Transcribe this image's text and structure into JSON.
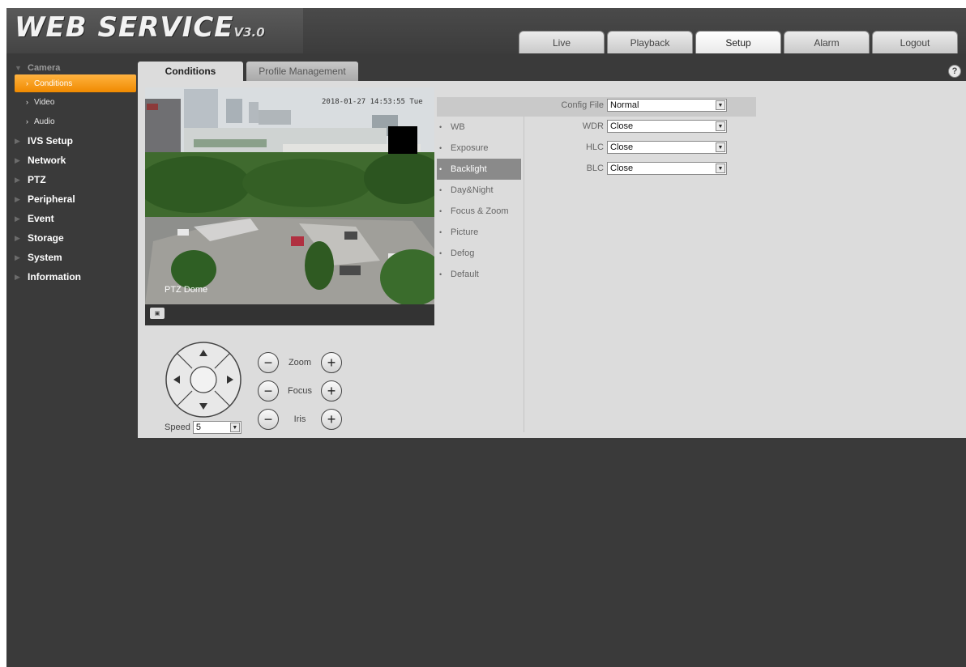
{
  "header": {
    "logo": "WEB SERVICE",
    "version": "V3.0",
    "nav": [
      {
        "label": "Live"
      },
      {
        "label": "Playback"
      },
      {
        "label": "Setup",
        "active": true
      },
      {
        "label": "Alarm"
      },
      {
        "label": "Logout"
      }
    ]
  },
  "sidebar": {
    "camera": "Camera",
    "camera_items": [
      {
        "label": "Conditions",
        "active": true
      },
      {
        "label": "Video"
      },
      {
        "label": "Audio"
      }
    ],
    "categories": [
      {
        "label": "IVS Setup"
      },
      {
        "label": "Network"
      },
      {
        "label": "PTZ"
      },
      {
        "label": "Peripheral"
      },
      {
        "label": "Event"
      },
      {
        "label": "Storage"
      },
      {
        "label": "System"
      },
      {
        "label": "Information"
      }
    ]
  },
  "tabs": {
    "active": "Conditions",
    "inactive": "Profile Management"
  },
  "help_icon": "?",
  "video": {
    "timestamp": "2018-01-27 14:53:55 Tue",
    "title": "PTZ Dome"
  },
  "ptz": {
    "zoom_label": "Zoom",
    "focus_label": "Focus",
    "iris_label": "Iris",
    "speed_label": "Speed",
    "speed_value": "5"
  },
  "submenu": [
    {
      "label": "WB"
    },
    {
      "label": "Exposure"
    },
    {
      "label": "Backlight",
      "active": true
    },
    {
      "label": "Day&Night"
    },
    {
      "label": "Focus & Zoom"
    },
    {
      "label": "Picture"
    },
    {
      "label": "Defog"
    },
    {
      "label": "Default"
    }
  ],
  "form": {
    "config_file": {
      "label": "Config File",
      "value": "Normal"
    },
    "wdr": {
      "label": "WDR",
      "value": "Close"
    },
    "hlc": {
      "label": "HLC",
      "value": "Close"
    },
    "blc": {
      "label": "BLC",
      "value": "Close"
    }
  },
  "colors": {
    "accent_orange": "#f08a00",
    "panel_bg": "#dcdcdc",
    "app_bg": "#3a3a3a"
  }
}
